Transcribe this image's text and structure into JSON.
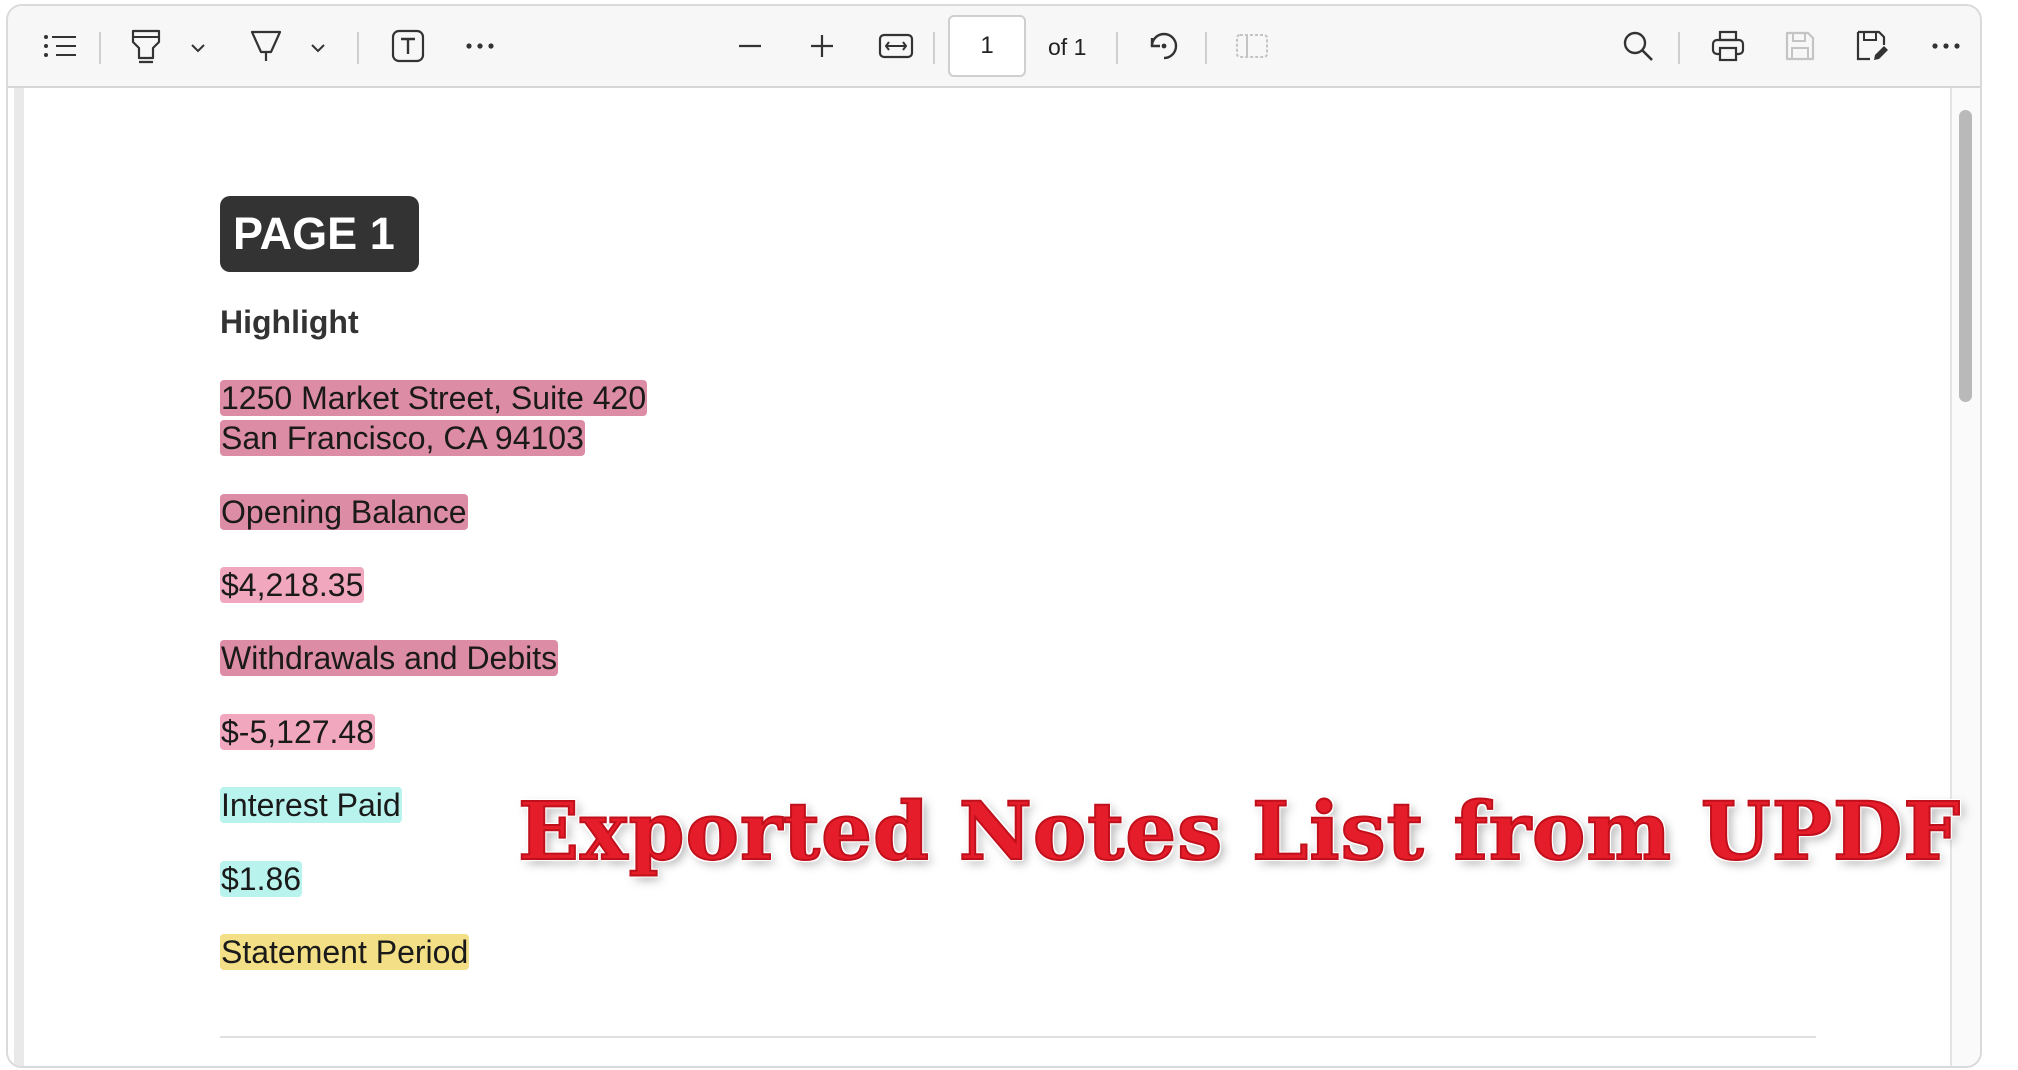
{
  "toolbar": {
    "page_current": "1",
    "page_of": "of 1",
    "icons": [
      "outline-icon",
      "highlighter-icon",
      "chevron-down-icon",
      "pen-icon",
      "chevron-down-icon",
      "text-box-icon",
      "more-icon",
      "zoom-out-icon",
      "zoom-in-icon",
      "fit-width-icon",
      "rotate-icon",
      "page-view-icon",
      "search-icon",
      "print-icon",
      "save-icon",
      "save-as-icon",
      "more-icon"
    ]
  },
  "document": {
    "badge": "PAGE 1",
    "section_title": "Highlight",
    "highlights": [
      {
        "lines": [
          "1250 Market Street, Suite 420",
          "San Francisco, CA 94103"
        ],
        "color": "#dd8ca5"
      },
      {
        "lines": [
          "Opening Balance"
        ],
        "color": "#dd8ca5"
      },
      {
        "lines": [
          "$4,218.35"
        ],
        "color": "#f1a8bf"
      },
      {
        "lines": [
          "Withdrawals and Debits"
        ],
        "color": "#dd8ca5"
      },
      {
        "lines": [
          "$-5,127.48"
        ],
        "color": "#f1a8bf"
      },
      {
        "lines": [
          "Interest Paid"
        ],
        "color": "#b9f3ee"
      },
      {
        "lines": [
          "$1.86"
        ],
        "color": "#b9f3ee"
      },
      {
        "lines": [
          "Statement Period"
        ],
        "color": "#f3df86"
      }
    ]
  },
  "overlay": {
    "title": "Exported Notes List from UPDF",
    "color": "#e51c29"
  }
}
